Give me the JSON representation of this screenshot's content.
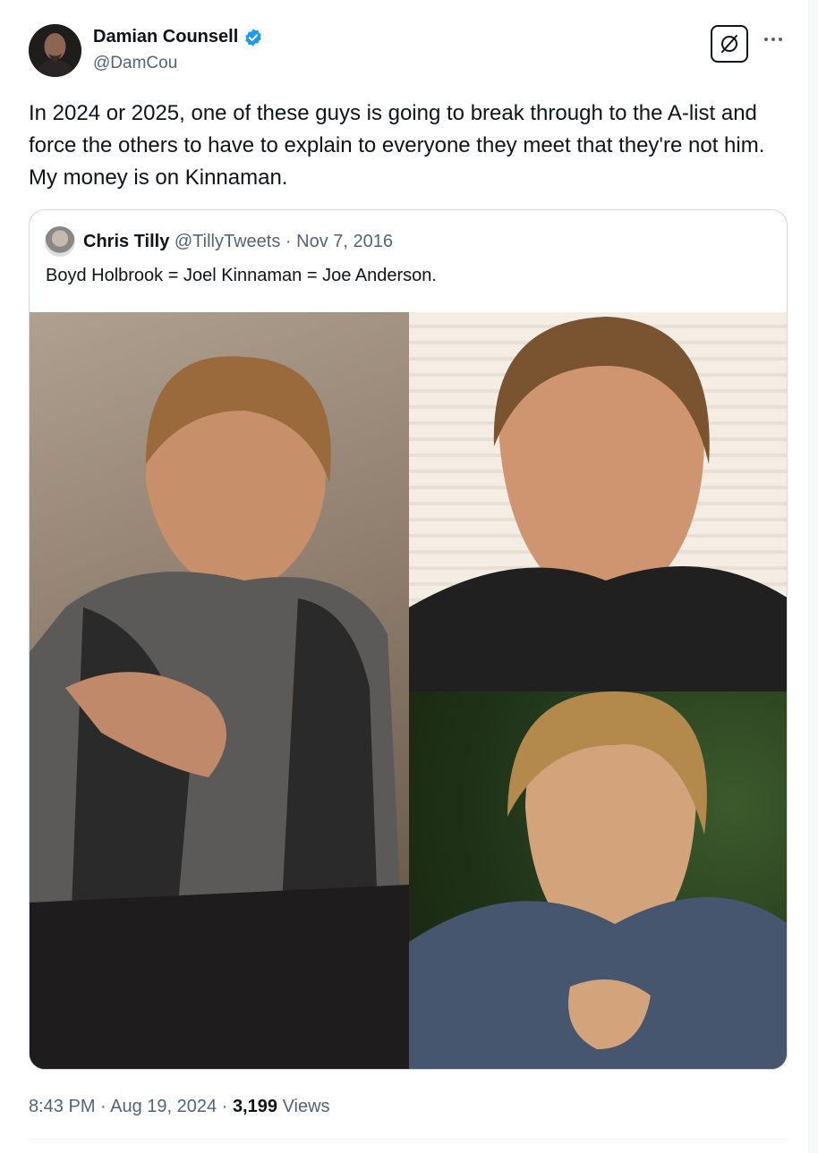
{
  "author": {
    "name": "Damian Counsell",
    "handle": "@DamCou",
    "verified": true,
    "verified_color": "#1d9bf0"
  },
  "tweet": {
    "text": "In 2024 or 2025, one of these guys is going to break through to the A-list and force the others to have to explain to everyone they meet that they're not him. My money is on Kinnaman."
  },
  "quote": {
    "name": "Chris Tilly",
    "handle": "@TillyTweets",
    "separator": " · ",
    "date": "Nov 7, 2016",
    "text": "Boyd Holbrook = Joel Kinnaman = Joe Anderson."
  },
  "meta": {
    "time": "8:43 PM",
    "separator": " · ",
    "date": "Aug 19, 2024",
    "views_count": "3,199",
    "views_label": "Views"
  },
  "icons": {
    "grok": "grok-slash-icon",
    "more": "more-dots-icon"
  }
}
